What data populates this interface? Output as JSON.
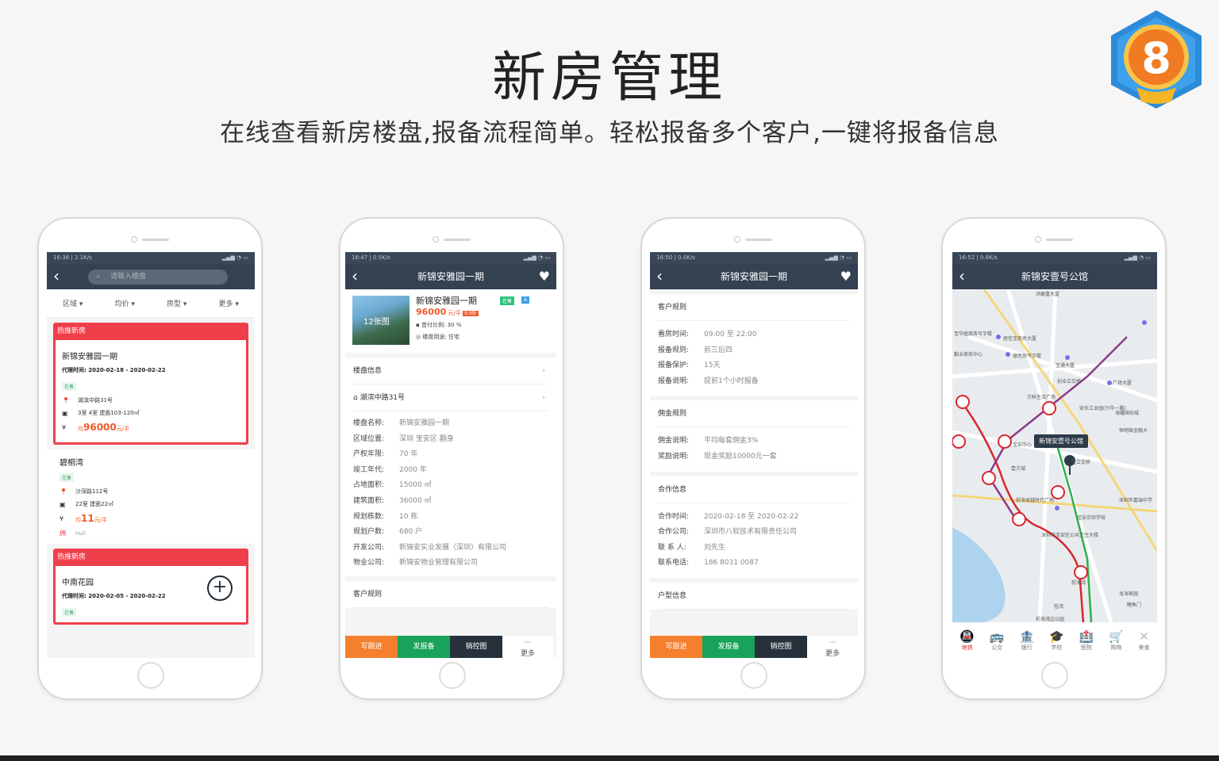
{
  "header": {
    "title": "新房管理",
    "subtitle": "在线查看新房楼盘,报备流程简单。轻松报备多个客户,一键将报备信息",
    "badge_number": "8"
  },
  "phone1": {
    "status_left": "16:36 | 2.1K/s",
    "search_placeholder": "请输入楼盘",
    "filters": [
      "区域 ▾",
      "均价 ▾",
      "房型 ▾",
      "更多 ▾"
    ],
    "card1": {
      "header": "热推新房",
      "name": "新锦安雅园一期",
      "date": "代理时间: 2020-02-18 - 2020-02-22",
      "tag": "在售",
      "address": "湖滨中路31号",
      "layout": "3室 4室 建面103-120㎡",
      "price_prefix": "均",
      "price": "96000",
      "price_unit": "元/平"
    },
    "card2": {
      "name": "碧桐湾",
      "tag": "在售",
      "address": "沙深路112号",
      "layout": "22室 建面22㎡",
      "price_prefix": "均",
      "price": "11",
      "price_unit": "元/平",
      "commission_icon": "佣",
      "commission": "null"
    },
    "card3": {
      "header": "热推新房",
      "name": "中南花园",
      "date": "代理时间: 2020-02-05 - 2020-02-22",
      "tag": "在售"
    }
  },
  "phone2": {
    "status_left": "16:47 | 0.5K/s",
    "title": "新锦安雅园一期",
    "thumb_label": "12张图",
    "name": "新锦安雅园一期",
    "tags": [
      "在售",
      "A"
    ],
    "price": "96000",
    "price_unit": "元/平",
    "discount": "9.9折",
    "down_payment": "首付比例: 30 %",
    "usage": "楼盘用途: 住宅",
    "section_info": "楼盘信息",
    "address": "湖滨中路31号",
    "details": [
      {
        "k": "楼盘名称:",
        "v": "新锦安雅园一期"
      },
      {
        "k": "区域位置:",
        "v": "深圳 宝安区 翻身"
      },
      {
        "k": "产权年限:",
        "v": "70 年"
      },
      {
        "k": "竣工年代:",
        "v": "2000 年"
      },
      {
        "k": "占地面积:",
        "v": "15000 ㎡"
      },
      {
        "k": "建筑面积:",
        "v": "36000 ㎡"
      },
      {
        "k": "规划栋数:",
        "v": "10 栋"
      },
      {
        "k": "规划户数:",
        "v": "680 户"
      },
      {
        "k": "开发公司:",
        "v": "新锦安实业发展（深圳）有限公司"
      },
      {
        "k": "物业公司:",
        "v": "新锦安物业管理有限公司"
      }
    ],
    "section_rules": "客户规则",
    "actions": [
      "写跟进",
      "发报备",
      "销控图",
      "更多"
    ]
  },
  "phone3": {
    "status_left": "16:50 | 0.0K/s",
    "title": "新锦安雅园一期",
    "rules_title": "客户规则",
    "rules": [
      {
        "k": "看房时间:",
        "v": "09:00 至 22:00"
      },
      {
        "k": "报备规则:",
        "v": "前三后四"
      },
      {
        "k": "报备保护:",
        "v": "15天"
      },
      {
        "k": "报备说明:",
        "v": "提前1个小时报备"
      }
    ],
    "commission_title": "佣金规则",
    "commission": [
      {
        "k": "佣金说明:",
        "v": "平均每套佣金3%"
      },
      {
        "k": "奖励说明:",
        "v": "现金奖励10000元一套"
      }
    ],
    "coop_title": "合作信息",
    "coop": [
      {
        "k": "合作时间:",
        "v": "2020-02-18 至 2020-02-22"
      },
      {
        "k": "合作公司:",
        "v": "深圳市八软技术有限责任公司"
      },
      {
        "k": "联 系 人:",
        "v": "刘先生"
      },
      {
        "k": "联系电话:",
        "v": "186 8031 0087"
      }
    ],
    "layout_title": "户型信息",
    "actions": [
      "写跟进",
      "发报备",
      "销控图",
      "更多"
    ]
  },
  "phone4": {
    "status_left": "16:52 | 0.8K/s",
    "title": "新锦安壹号公馆",
    "callout": "新锦安壹号公馆",
    "map_labels": [
      "鸿泰富大厦",
      "宝华庭商务写字楼",
      "居信宝商务大厦",
      "勤业商务中心",
      "德思居写字楼",
      "宝通大厦",
      "创业立交桥",
      "广场大厦",
      "万科生活广场",
      "安乐工业园(兴华一路)",
      "海耀缤纷城",
      "恒明珠金融大",
      "宝安中心",
      "宝立交桥",
      "壹方城",
      "前海卓越时代广场",
      "深圳市嘉瑞中学",
      "宝安实验学校",
      "深圳市宝安区公共卫生大楼",
      "前海湾",
      "龙海家园",
      "桂湾",
      "前海湾边公园",
      "鲤鱼门"
    ],
    "tabs": [
      {
        "icon": "🚇",
        "label": "地铁"
      },
      {
        "icon": "🚌",
        "label": "公交"
      },
      {
        "icon": "🏦",
        "label": "银行"
      },
      {
        "icon": "🎓",
        "label": "学校"
      },
      {
        "icon": "🏥",
        "label": "医院"
      },
      {
        "icon": "🛒",
        "label": "购物"
      },
      {
        "icon": "✕",
        "label": "美食"
      }
    ]
  },
  "colors": {
    "nav": "#334151",
    "hot_red": "#ef3f4a",
    "price_orange": "#ef5a2b",
    "action_orange": "#f47f2c",
    "action_green": "#19a35a",
    "action_dark": "#27313c"
  }
}
